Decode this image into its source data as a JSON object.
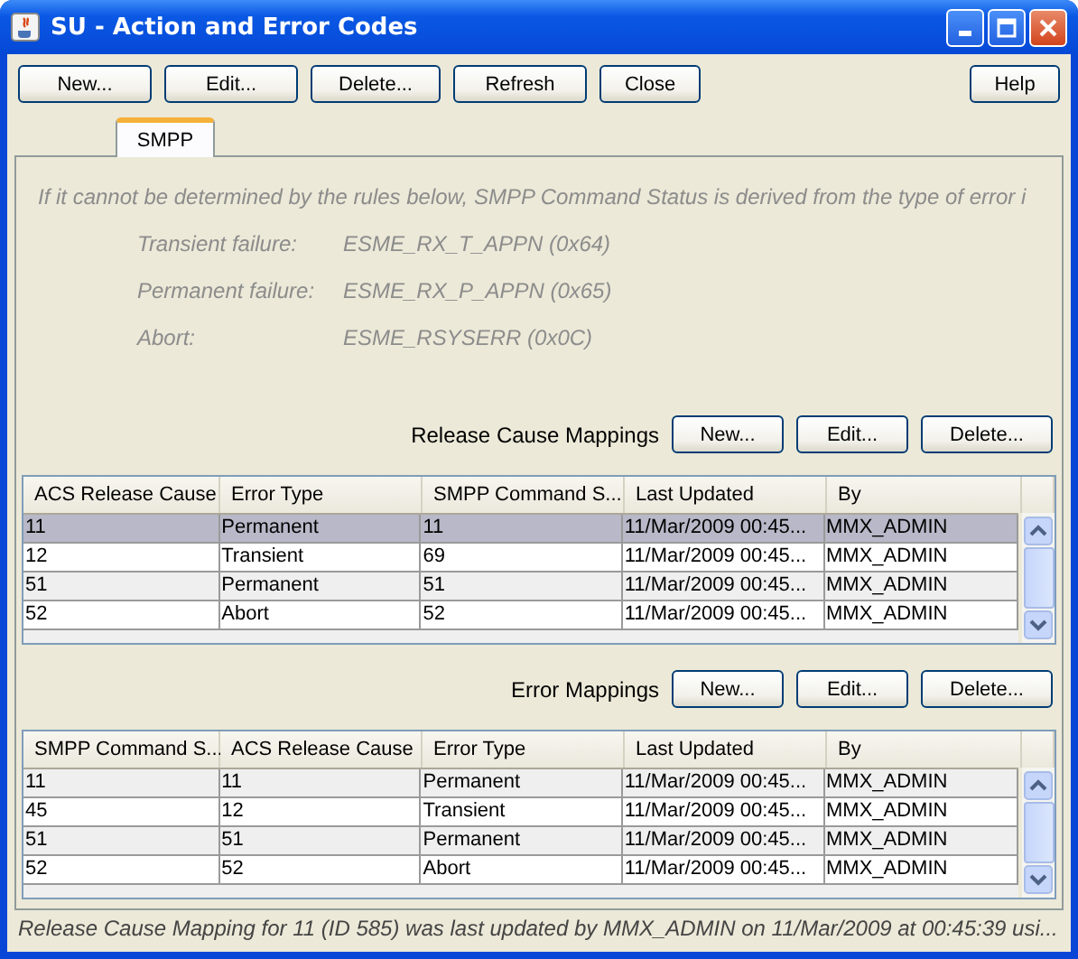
{
  "window": {
    "title": "SU - Action and Error Codes"
  },
  "toolbar": {
    "buttons": [
      "New...",
      "Edit...",
      "Delete...",
      "Refresh",
      "Close"
    ],
    "help": "Help"
  },
  "tabs": [
    {
      "label": "SMPP",
      "selected": true
    }
  ],
  "info": {
    "text": "If it cannot be determined by the rules below, SMPP Command Status is derived from the type of error i",
    "rows": [
      {
        "label": "Transient failure:",
        "value": "ESME_RX_T_APPN (0x64)"
      },
      {
        "label": "Permanent failure:",
        "value": "ESME_RX_P_APPN (0x65)"
      },
      {
        "label": "Abort:",
        "value": "ESME_RSYSERR (0x0C)"
      }
    ]
  },
  "sections": [
    {
      "label": "Release Cause Mappings",
      "buttons": [
        "New...",
        "Edit...",
        "Delete..."
      ],
      "table": {
        "columns": [
          "ACS Release Cause",
          "Error Type",
          "SMPP Command S...",
          "Last Updated",
          "By"
        ],
        "rows": [
          {
            "cells": [
              "11",
              "Permanent",
              "11",
              "11/Mar/2009 00:45...",
              "MMX_ADMIN"
            ],
            "selected": true
          },
          {
            "cells": [
              "12",
              "Transient",
              "69",
              "11/Mar/2009 00:45...",
              "MMX_ADMIN"
            ],
            "selected": false
          },
          {
            "cells": [
              "51",
              "Permanent",
              "51",
              "11/Mar/2009 00:45...",
              "MMX_ADMIN"
            ],
            "selected": false
          },
          {
            "cells": [
              "52",
              "Abort",
              "52",
              "11/Mar/2009 00:45...",
              "MMX_ADMIN"
            ],
            "selected": false
          }
        ]
      }
    },
    {
      "label": "Error Mappings",
      "buttons": [
        "New...",
        "Edit...",
        "Delete..."
      ],
      "table": {
        "columns": [
          "SMPP Command S...",
          "ACS Release Cause",
          "Error Type",
          "Last Updated",
          "By"
        ],
        "rows": [
          {
            "cells": [
              "11",
              "11",
              "Permanent",
              "11/Mar/2009 00:45...",
              "MMX_ADMIN"
            ],
            "selected": false
          },
          {
            "cells": [
              "45",
              "12",
              "Transient",
              "11/Mar/2009 00:45...",
              "MMX_ADMIN"
            ],
            "selected": false
          },
          {
            "cells": [
              "51",
              "51",
              "Permanent",
              "11/Mar/2009 00:45...",
              "MMX_ADMIN"
            ],
            "selected": false
          },
          {
            "cells": [
              "52",
              "52",
              "Abort",
              "11/Mar/2009 00:45...",
              "MMX_ADMIN"
            ],
            "selected": false
          }
        ]
      }
    }
  ],
  "status_bar": "Release Cause Mapping for 11 (ID 585) was last updated by MMX_ADMIN on 11/Mar/2009 at 00:45:39 usi..."
}
